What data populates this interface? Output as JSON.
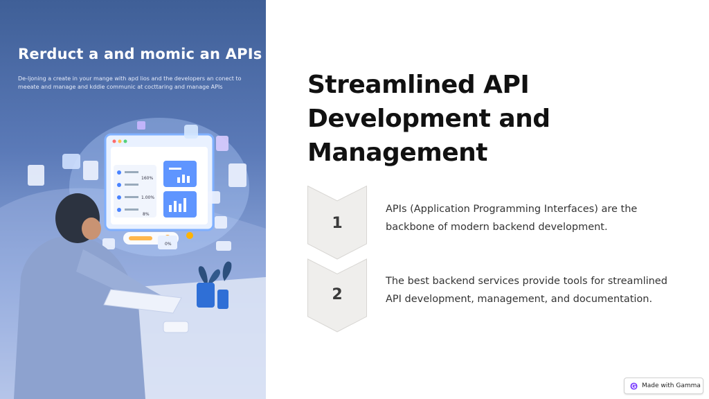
{
  "hero": {
    "title": "Rerduct a and momic an APIs",
    "subtitle_lines": [
      "De-ljoning a create in your mange with apd lios and the developers an conect to",
      "meeate and manage and kddie communic at cocttaring and manage APIs"
    ],
    "dashboard_values": [
      "160%",
      "1.00%",
      "8%",
      "0%"
    ],
    "illustration_icons": [
      "developer-figure",
      "laptop",
      "monitor-dashboard",
      "plant",
      "floating-app-card",
      "cloud",
      "shield",
      "gear"
    ]
  },
  "slide": {
    "title_lines": [
      "Streamlined API",
      "Development and",
      "Management"
    ]
  },
  "steps": [
    {
      "number": "1",
      "lines": [
        "APIs (Application Programming Interfaces) are the",
        "backbone of modern backend development."
      ]
    },
    {
      "number": "2",
      "lines": [
        "The best backend services provide tools for streamlined",
        "API development, management, and documentation."
      ]
    }
  ],
  "badge": {
    "label": "Made with Gamma",
    "icon": "gamma-logo-icon"
  },
  "colors": {
    "arrow_fill": "#efeeec",
    "arrow_stroke": "#d8d6d3",
    "title": "#111111",
    "hero_top": "#3f5f97"
  }
}
